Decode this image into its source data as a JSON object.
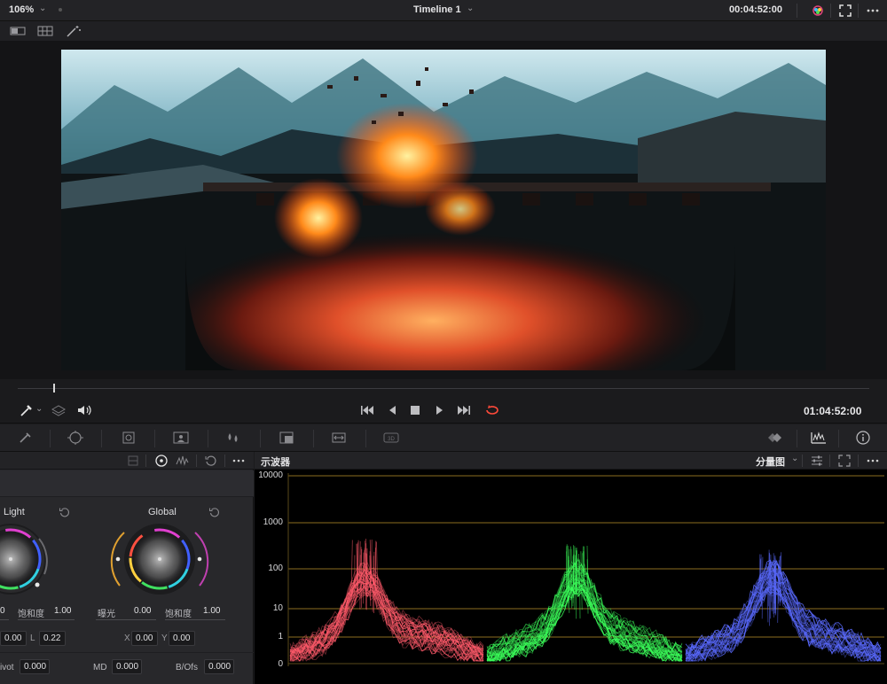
{
  "topbar": {
    "zoom": "106%",
    "timeline_title": "Timeline 1",
    "timecode": "00:04:52:00",
    "caret": "⌄"
  },
  "viewer": {
    "playhead_fraction": 0.042
  },
  "transport": {
    "timecode": "01:04:52:00"
  },
  "color_panel": {
    "wheel_left_title": "Light",
    "wheel_right_title": "Global",
    "left_val_truncated": "0",
    "saturation_label_left": "饱和度",
    "saturation_value_left": "1.00",
    "exposure_label": "曝光",
    "exposure_value": "0.00",
    "saturation_label_right": "饱和度",
    "saturation_value_right": "1.00",
    "left_x_value": "0.00",
    "left_box2_prefix": "L",
    "left_box2_value": "0.22",
    "global_x_label": "X",
    "global_x_value": "0.00",
    "global_y_label": "Y",
    "global_y_value": "0.00",
    "pivot_label": "ivot",
    "pivot_value": "0.000",
    "md_label": "MD",
    "md_value": "0.000",
    "bofs_label": "B/Ofs",
    "bofs_value": "0.000"
  },
  "scope": {
    "title": "示波器",
    "mode": "分量图",
    "y_labels": [
      "10000",
      "1000",
      "100",
      "10",
      "1",
      "0"
    ],
    "colors": {
      "red": "#ff5a6a",
      "green": "#3cff5a",
      "blue": "#5a6aff",
      "grid": "#b08a2a"
    }
  }
}
